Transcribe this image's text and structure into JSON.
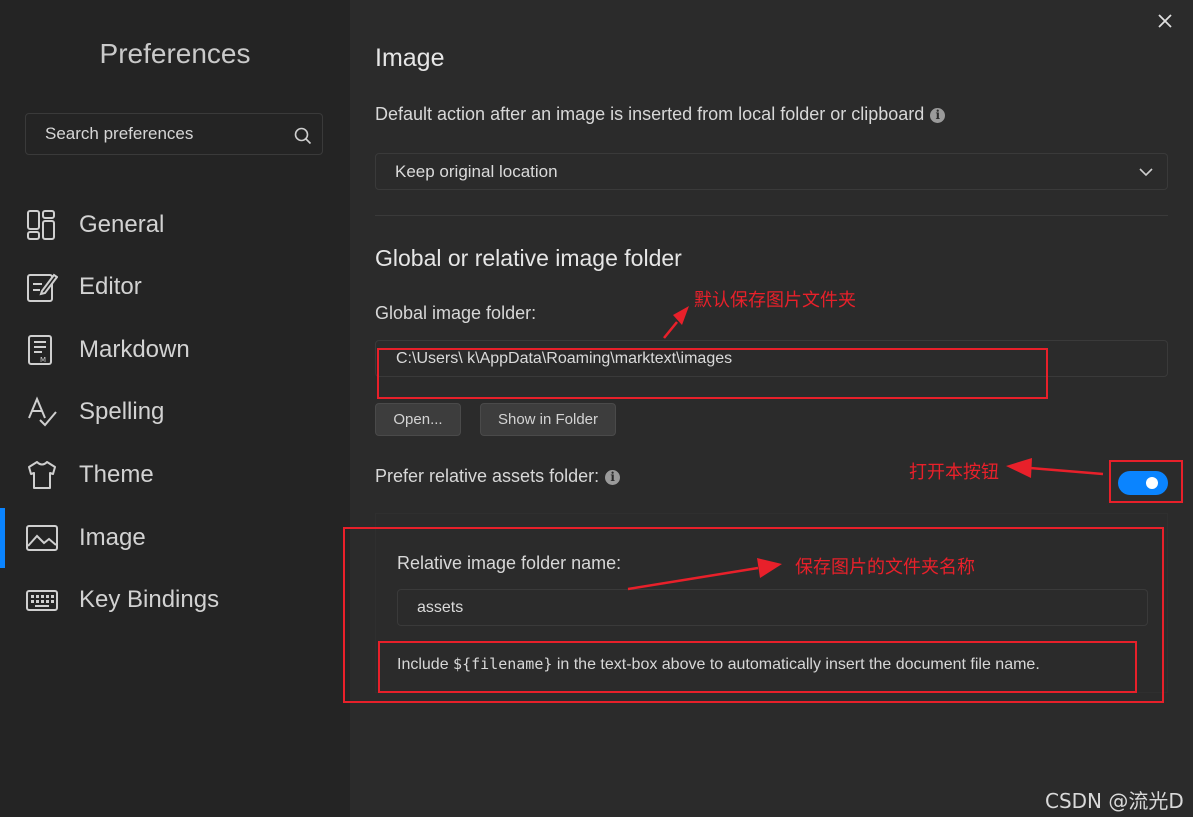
{
  "sidebar": {
    "title": "Preferences",
    "search_placeholder": "Search preferences",
    "items": [
      {
        "label": "General",
        "icon": "general-icon"
      },
      {
        "label": "Editor",
        "icon": "editor-icon"
      },
      {
        "label": "Markdown",
        "icon": "markdown-icon"
      },
      {
        "label": "Spelling",
        "icon": "spelling-icon"
      },
      {
        "label": "Theme",
        "icon": "theme-icon"
      },
      {
        "label": "Image",
        "icon": "image-icon",
        "active": true
      },
      {
        "label": "Key Bindings",
        "icon": "keyboard-icon"
      }
    ]
  },
  "main": {
    "section_title": "Image",
    "default_action_label": "Default action after an image is inserted from local folder or clipboard",
    "default_action_value": "Keep original location",
    "folder_section_title": "Global or relative image folder",
    "global_folder_label": "Global image folder:",
    "global_folder_path": "C:\\Users\\   k\\AppData\\Roaming\\marktext\\images",
    "open_button": "Open...",
    "show_in_folder_button": "Show in Folder",
    "prefer_relative_label": "Prefer relative assets folder:",
    "prefer_relative_enabled": true,
    "relative_folder_label": "Relative image folder name:",
    "relative_folder_value": "assets",
    "hint_prefix": "Include ",
    "hint_code": "${filename}",
    "hint_suffix": " in the text-box above to automatically insert the document file name."
  },
  "annotations": {
    "default_folder_note": "默认保存图片文件夹",
    "toggle_note": "打开本按钮",
    "folder_name_note": "保存图片的文件夹名称"
  },
  "watermark": "CSDN @流光D",
  "colors": {
    "accent": "#0a84ff",
    "annotation": "#e8202a",
    "sidebar_bg": "#242424",
    "main_bg": "#2b2b2b"
  }
}
